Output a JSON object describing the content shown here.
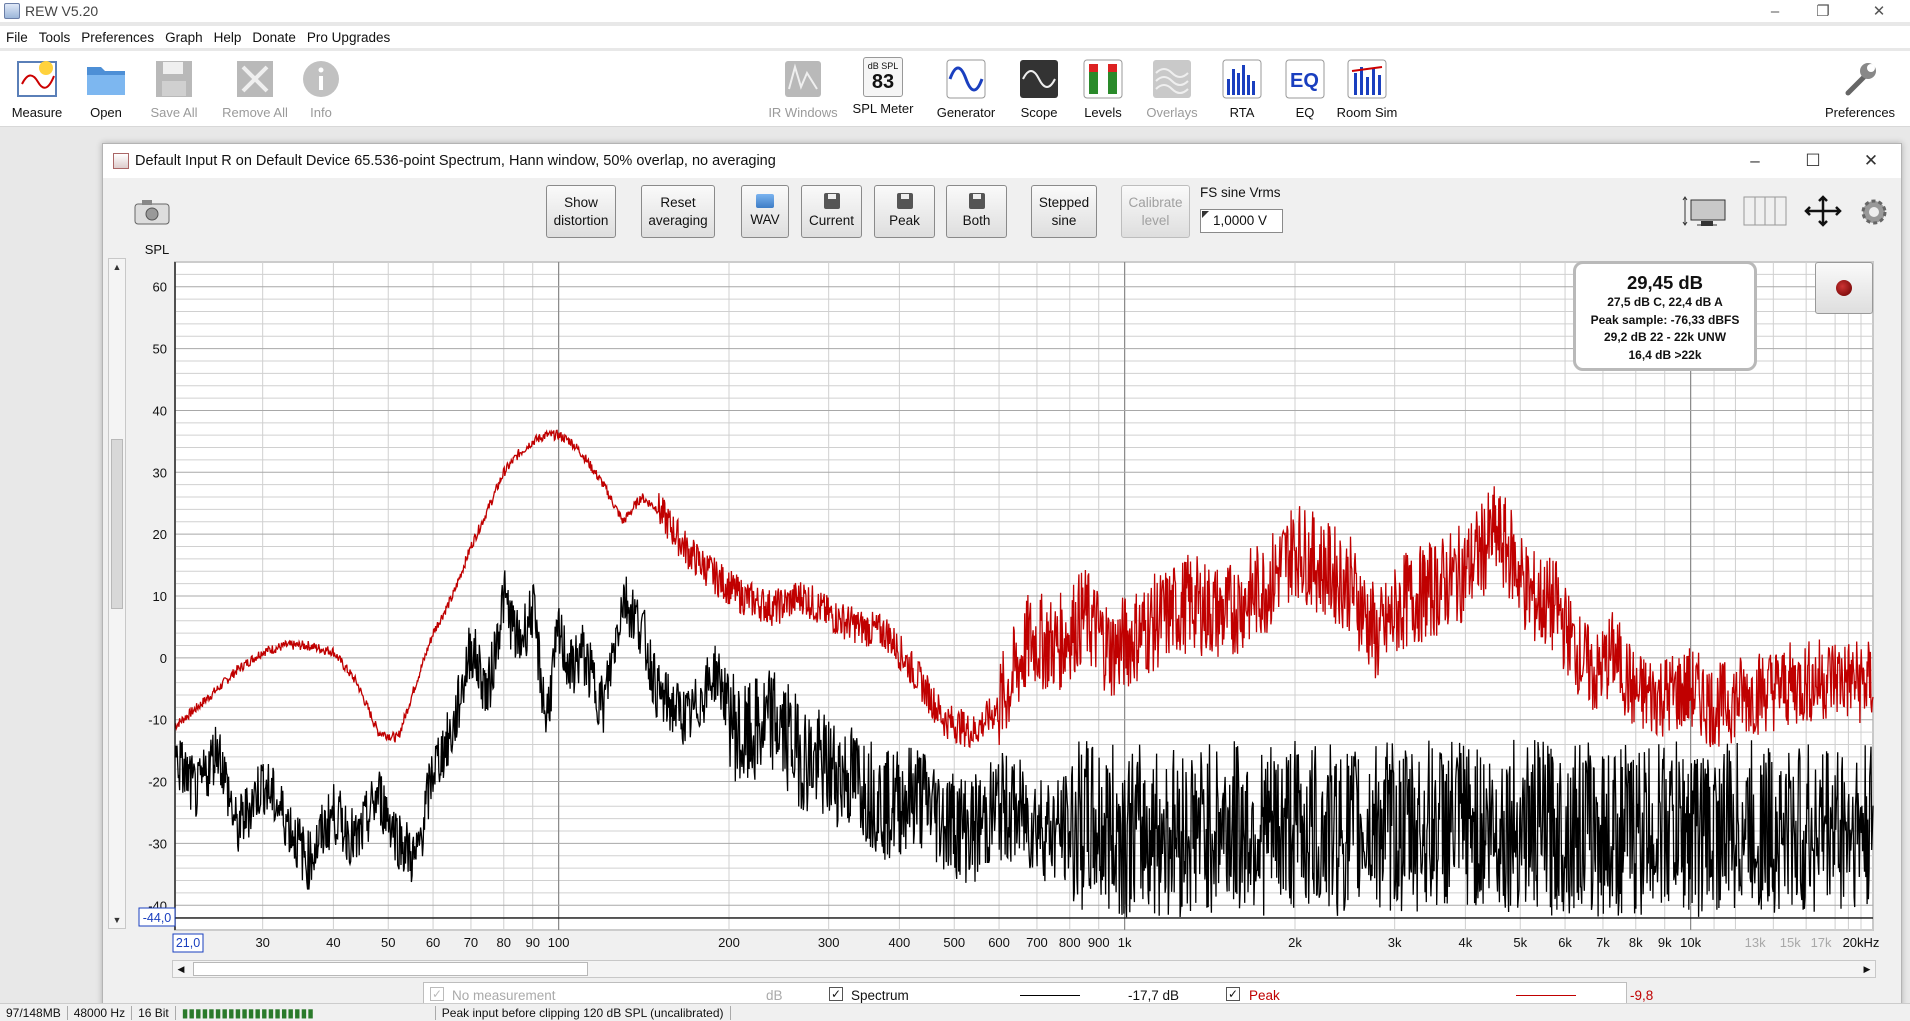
{
  "app": {
    "title": "REW V5.20"
  },
  "menu": [
    "File",
    "Tools",
    "Preferences",
    "Graph",
    "Help",
    "Donate",
    "Pro Upgrades"
  ],
  "toolbar": {
    "measure": "Measure",
    "open": "Open",
    "save_all": "Save All",
    "remove_all": "Remove All",
    "info": "Info",
    "ir_windows": "IR Windows",
    "spl_meter": "SPL Meter",
    "spl_meter_top": "dB SPL",
    "spl_meter_value": "83",
    "generator": "Generator",
    "scope": "Scope",
    "levels": "Levels",
    "overlays": "Overlays",
    "rta": "RTA",
    "eq": "EQ",
    "eq_glyph": "EQ",
    "room_sim": "Room Sim",
    "preferences": "Preferences"
  },
  "rta_window": {
    "title": "Default Input R on Default Device 65.536-point Spectrum, Hann window, 50% overlap, no averaging",
    "buttons": {
      "show_distortion": [
        "Show",
        "distortion"
      ],
      "reset_averaging": [
        "Reset",
        "averaging"
      ],
      "wav": "WAV",
      "current": "Current",
      "peak": "Peak",
      "both": "Both",
      "stepped_sine": [
        "Stepped",
        "sine"
      ],
      "calibrate_level": [
        "Calibrate",
        "level"
      ]
    },
    "fs_sine_label": "FS sine Vrms",
    "fs_sine_value": "1,0000 V"
  },
  "readout": {
    "main": "29,45 dB",
    "line1": "27,5 dB C, 22,4 dB A",
    "line2": "Peak sample: -76,33 dBFS",
    "line3": "29,2 dB 22 - 22k UNW",
    "line4": "16,4 dB >22k"
  },
  "chart_data": {
    "type": "line",
    "ylabel": "SPL",
    "xlabel": "",
    "x_scale": "log",
    "xlim": [
      21,
      21000
    ],
    "ylim": [
      -44,
      64
    ],
    "x_cursor_label": "21,0",
    "y_cursor_label": "-44,0",
    "y_ticks": [
      60,
      50,
      40,
      30,
      20,
      10,
      0,
      -10,
      -20,
      -30,
      -40
    ],
    "x_ticks": [
      {
        "v": 30,
        "t": "30"
      },
      {
        "v": 40,
        "t": "40"
      },
      {
        "v": 50,
        "t": "50"
      },
      {
        "v": 60,
        "t": "60"
      },
      {
        "v": 70,
        "t": "70"
      },
      {
        "v": 80,
        "t": "80"
      },
      {
        "v": 90,
        "t": "90"
      },
      {
        "v": 100,
        "t": "100"
      },
      {
        "v": 200,
        "t": "200"
      },
      {
        "v": 300,
        "t": "300"
      },
      {
        "v": 400,
        "t": "400"
      },
      {
        "v": 500,
        "t": "500"
      },
      {
        "v": 600,
        "t": "600"
      },
      {
        "v": 700,
        "t": "700"
      },
      {
        "v": 800,
        "t": "800"
      },
      {
        "v": 900,
        "t": "900"
      },
      {
        "v": 1000,
        "t": "1k"
      },
      {
        "v": 2000,
        "t": "2k"
      },
      {
        "v": 3000,
        "t": "3k"
      },
      {
        "v": 4000,
        "t": "4k"
      },
      {
        "v": 5000,
        "t": "5k"
      },
      {
        "v": 6000,
        "t": "6k"
      },
      {
        "v": 7000,
        "t": "7k"
      },
      {
        "v": 8000,
        "t": "8k"
      },
      {
        "v": 9000,
        "t": "9k"
      },
      {
        "v": 10000,
        "t": "10k"
      },
      {
        "v": 13000,
        "t": "13k"
      },
      {
        "v": 15000,
        "t": "15k"
      },
      {
        "v": 17000,
        "t": "17k"
      },
      {
        "v": 20000,
        "t": "20kHz"
      }
    ],
    "series": [
      {
        "name": "Peak",
        "color": "#c00000",
        "x": [
          21,
          23,
          25,
          27,
          30,
          33,
          36,
          40,
          44,
          48,
          52,
          56,
          60,
          65,
          70,
          75,
          80,
          85,
          90,
          95,
          100,
          105,
          110,
          120,
          130,
          140,
          150,
          170,
          190,
          210,
          240,
          270,
          300,
          340,
          380,
          430,
          480,
          540,
          600,
          680,
          760,
          850,
          950,
          1100,
          1300,
          1500,
          1800,
          2000,
          2200,
          2500,
          2800,
          3100,
          3500,
          4000,
          4500,
          4800,
          5200,
          5800,
          6300,
          6800,
          7300,
          8000,
          9000,
          10000,
          11000,
          12500,
          14000,
          16000,
          18000,
          20000
        ],
        "y": [
          -11,
          -8,
          -5,
          -2,
          1,
          2,
          2,
          1,
          -4,
          -12,
          -13,
          -4,
          4,
          10,
          18,
          24,
          30,
          33,
          35,
          36,
          36,
          35,
          33,
          28,
          22,
          26,
          24,
          17,
          13,
          10,
          8,
          10,
          7,
          5,
          4,
          -3,
          -10,
          -12,
          -8,
          3,
          2,
          7,
          1,
          5,
          9,
          7,
          12,
          18,
          15,
          12,
          3,
          9,
          11,
          14,
          20,
          17,
          10,
          8,
          1,
          -3,
          1,
          -6,
          -6,
          -5,
          -8,
          -6,
          -5,
          -4,
          -3,
          -4
        ]
      },
      {
        "name": "Spectrum",
        "color": "#000000",
        "x": [
          21,
          23,
          25,
          27,
          30,
          33,
          36,
          40,
          44,
          48,
          52,
          56,
          60,
          65,
          70,
          75,
          80,
          85,
          90,
          95,
          100,
          105,
          110,
          120,
          130,
          140,
          150,
          170,
          190,
          210,
          240,
          270,
          300,
          340,
          380,
          430,
          480,
          540,
          600,
          680,
          760,
          850,
          950,
          1100,
          1300,
          1500,
          1800,
          2000,
          2200,
          2500,
          2800,
          3100,
          3500,
          4000,
          4500,
          4800,
          5200,
          5800,
          6300,
          6800,
          7300,
          8000,
          9000,
          10000,
          11000,
          12500,
          14000,
          16000,
          18000,
          20000
        ],
        "y": [
          -16,
          -22,
          -14,
          -28,
          -20,
          -26,
          -33,
          -25,
          -30,
          -22,
          -29,
          -33,
          -18,
          -12,
          2,
          -6,
          10,
          2,
          8,
          -10,
          4,
          -2,
          1,
          -8,
          10,
          5,
          -6,
          -10,
          -2,
          -14,
          -10,
          -16,
          -18,
          -20,
          -24,
          -22,
          -26,
          -28,
          -24,
          -26,
          -28,
          -27,
          -28,
          -28,
          -28,
          -27,
          -28,
          -27,
          -28,
          -28,
          -27,
          -28,
          -27,
          -27,
          -28,
          -27,
          -27,
          -28,
          -27,
          -28,
          -28,
          -28,
          -27,
          -28,
          -28,
          -27,
          -28,
          -28,
          -27,
          -28
        ]
      }
    ]
  },
  "legend": {
    "no_measurement": "No measurement",
    "no_measurement_unit": "dB",
    "spectrum": "Spectrum",
    "spectrum_value": "-17,7 dB",
    "peak": "Peak",
    "peak_value": "-9,8 dB"
  },
  "status": {
    "memory": "97/148MB",
    "rate": "48000 Hz",
    "bits": "16 Bit",
    "meter": "Peak input before clipping 120 dB SPL (uncalibrated)"
  },
  "colors": {
    "peak": "#c00000",
    "spectrum": "#000000",
    "grid_major": "#8a8a8a",
    "grid_minor": "#d0d0d0"
  }
}
